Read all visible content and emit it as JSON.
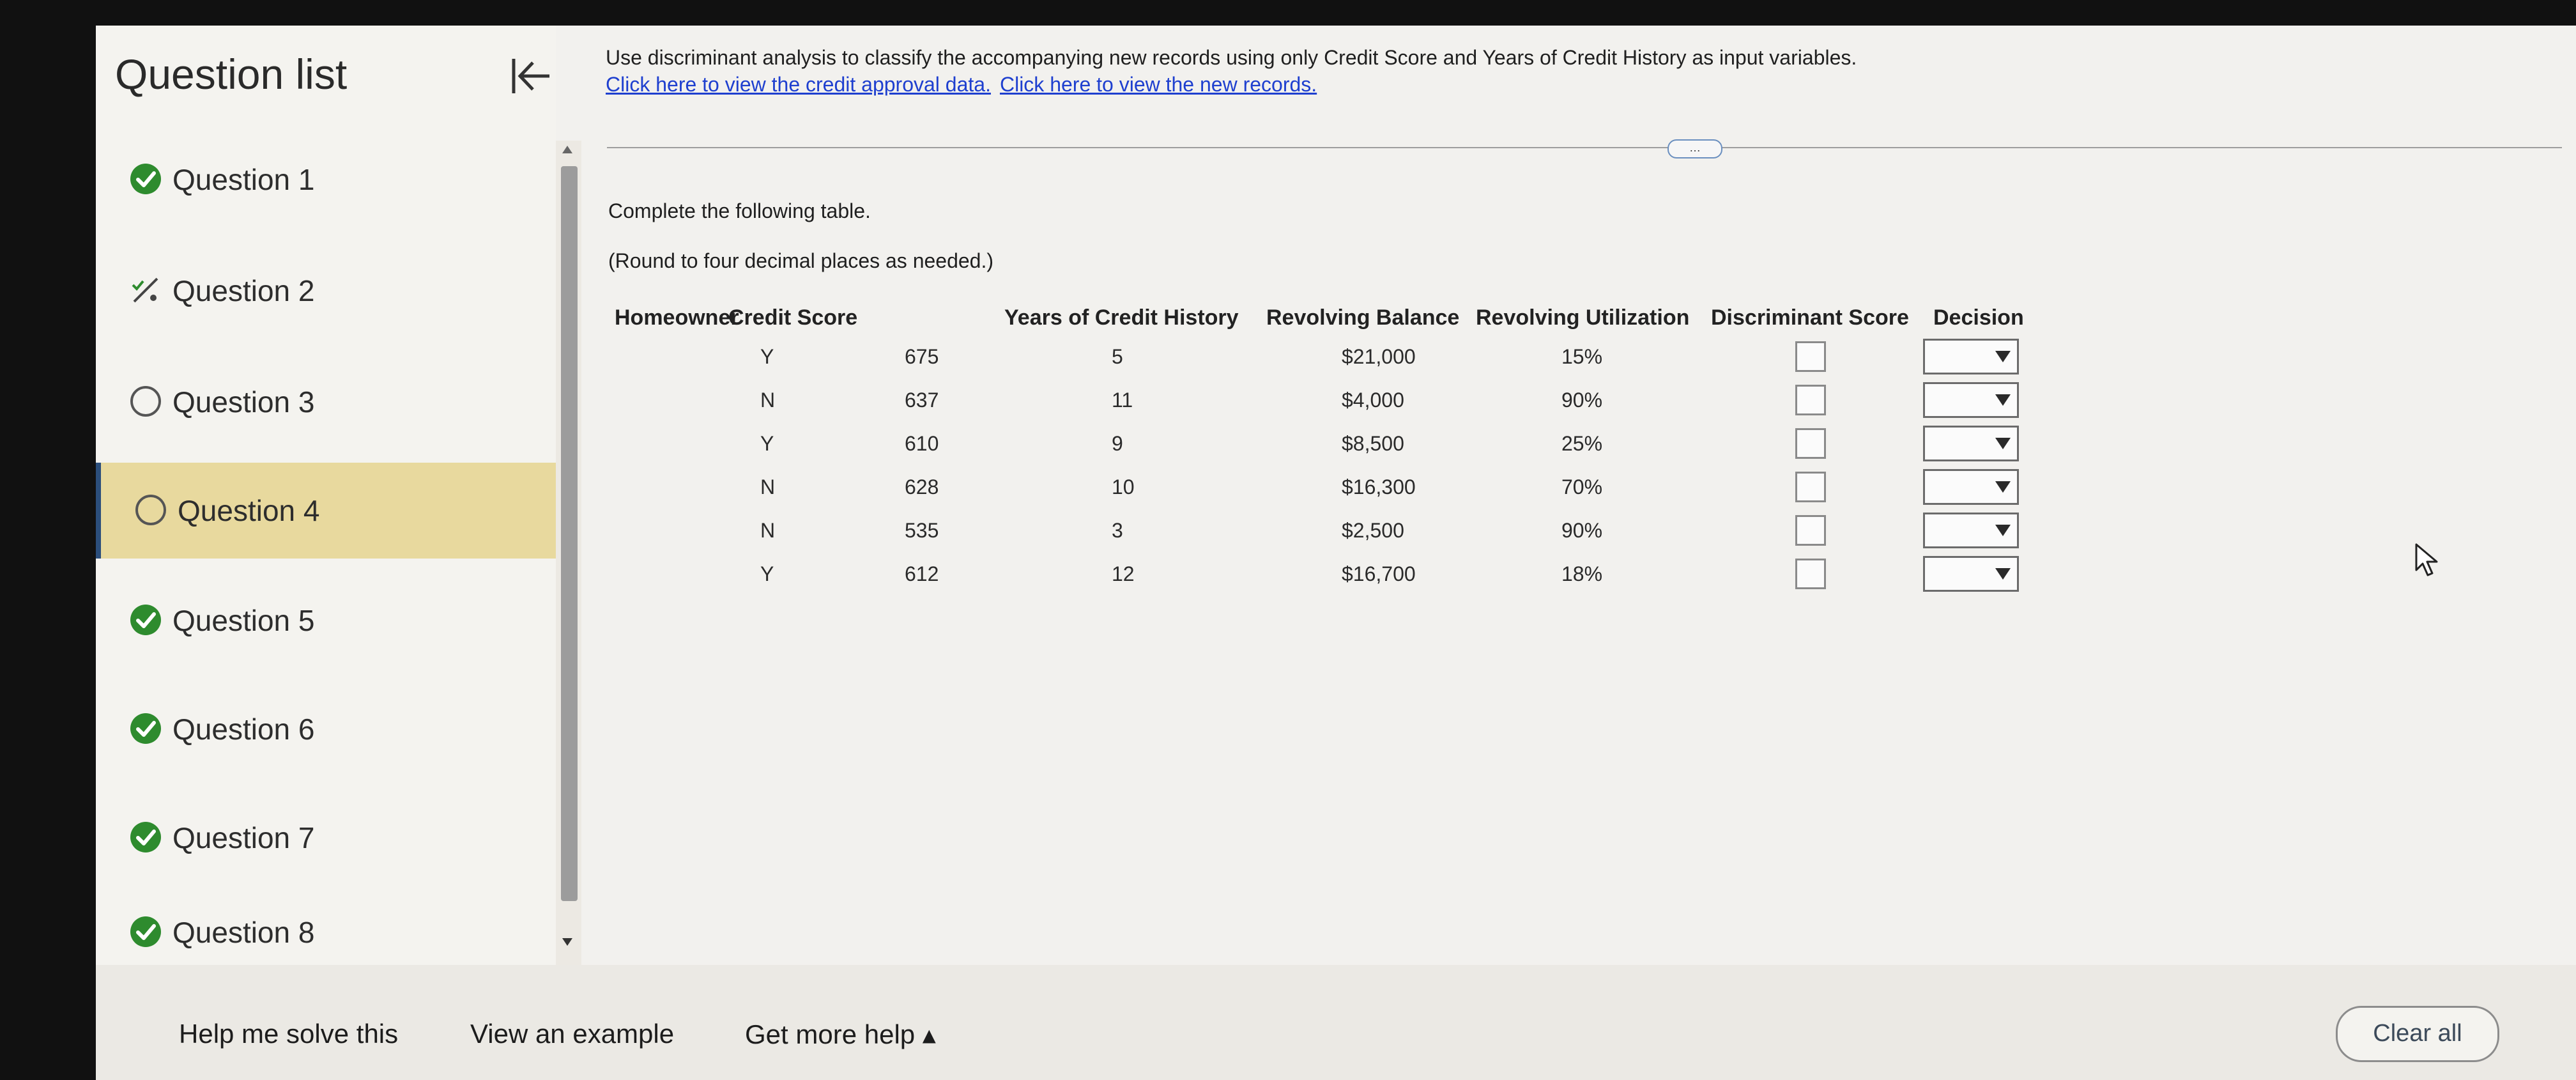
{
  "sidebar": {
    "title": "Question list",
    "items": [
      {
        "label": "Question 1",
        "status": "complete"
      },
      {
        "label": "Question 2",
        "status": "partial"
      },
      {
        "label": "Question 3",
        "status": "unanswered"
      },
      {
        "label": "Question 4",
        "status": "current"
      },
      {
        "label": "Question 5",
        "status": "complete"
      },
      {
        "label": "Question 6",
        "status": "complete"
      },
      {
        "label": "Question 7",
        "status": "complete"
      },
      {
        "label": "Question 8",
        "status": "complete"
      }
    ]
  },
  "main": {
    "instructions": "Use discriminant analysis to classify the accompanying new records using only Credit Score and Years of Credit History as input variables.",
    "link1": "Click here to view the credit approval data.",
    "link2": "Click here to view the new records.",
    "more_button": "…",
    "complete": "Complete the following table.",
    "round": "(Round to four decimal places as needed.)",
    "table": {
      "headers": [
        "Homeowner",
        "Credit Score",
        "Years of Credit History",
        "Revolving Balance",
        "Revolving Utilization",
        "Discriminant Score",
        "Decision"
      ],
      "rows": [
        [
          "Y",
          "675",
          "5",
          "$21,000",
          "15%"
        ],
        [
          "N",
          "637",
          "11",
          "$4,000",
          "90%"
        ],
        [
          "Y",
          "610",
          "9",
          "$8,500",
          "25%"
        ],
        [
          "N",
          "628",
          "10",
          "$16,300",
          "70%"
        ],
        [
          "N",
          "535",
          "3",
          "$2,500",
          "90%"
        ],
        [
          "Y",
          "612",
          "12",
          "$16,700",
          "18%"
        ]
      ]
    }
  },
  "bottom": {
    "help": "Help me solve this",
    "example": "View an example",
    "more_help": "Get more help ▴",
    "clear": "Clear all"
  },
  "colors": {
    "complete_green": "#2e8b2e",
    "active_bg": "#e8d99e",
    "link_blue": "#1e3fcf"
  }
}
